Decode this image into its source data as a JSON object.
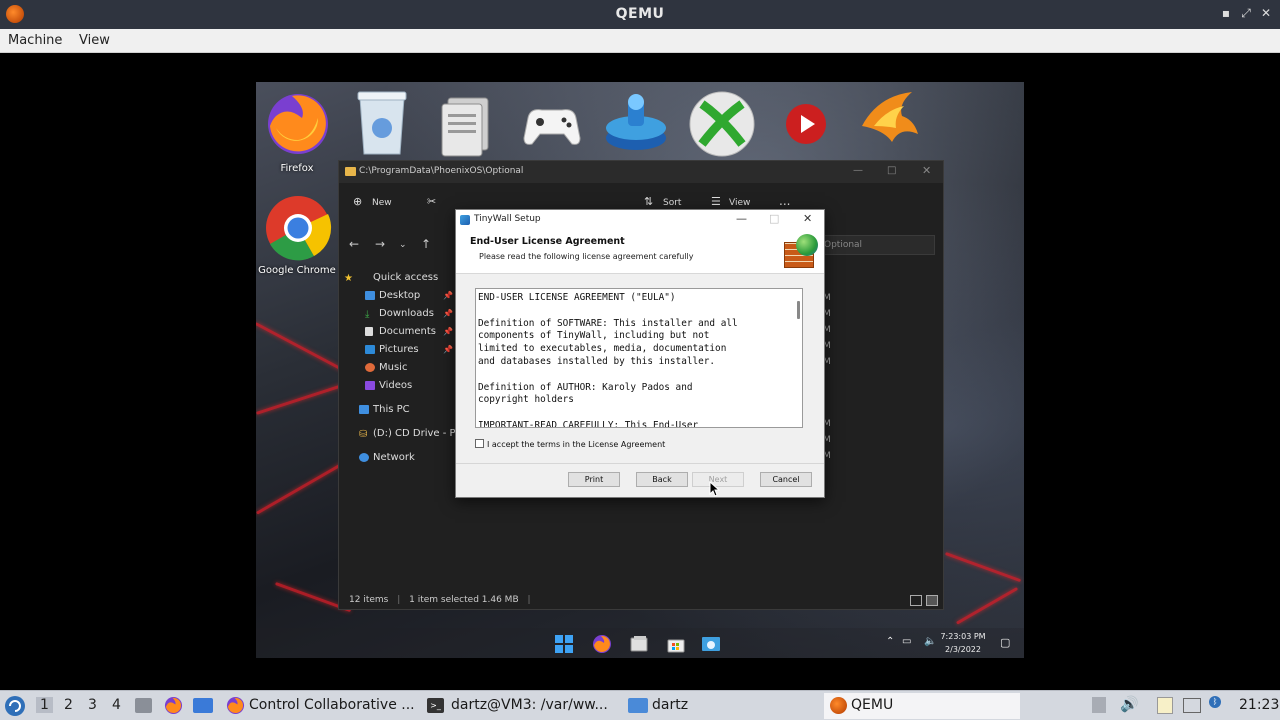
{
  "qemu": {
    "title": "QEMU",
    "menu": [
      "Machine",
      "View"
    ],
    "controls": {
      "minimize": "▪",
      "maximize": "⤢",
      "close": "✕"
    }
  },
  "desktop": {
    "icons": [
      {
        "name": "firefox",
        "label": "Firefox"
      },
      {
        "name": "recycle-bin",
        "label": ""
      },
      {
        "name": "files",
        "label": ""
      },
      {
        "name": "gamepad",
        "label": ""
      },
      {
        "name": "disk",
        "label": ""
      },
      {
        "name": "xbox",
        "label": ""
      },
      {
        "name": "youtube",
        "label": ""
      },
      {
        "name": "phoenix",
        "label": ""
      },
      {
        "name": "chrome",
        "label": "Google Chrome"
      }
    ]
  },
  "explorer": {
    "path": "C:\\ProgramData\\PhoenixOS\\Optional",
    "toolbar": {
      "new": "New",
      "sort": "Sort",
      "view": "View",
      "more": "..."
    },
    "search_placeholder": "Optional",
    "sidebar": {
      "quick_access": "Quick access",
      "items": [
        "Desktop",
        "Downloads",
        "Documents",
        "Pictures",
        "Music",
        "Videos"
      ],
      "this_pc": "This PC",
      "cd_drive": "(D:) CD Drive - Pho",
      "network": "Network"
    },
    "status": {
      "items": "12 items",
      "selected": "1 item selected  1.46 MB"
    },
    "fragments": [
      "M",
      "M",
      "M",
      "M",
      "M",
      "M",
      "M",
      "M"
    ]
  },
  "dialog": {
    "title": "TinyWall Setup",
    "header_title": "End-User License Agreement",
    "header_subtitle": "Please read the following license agreement carefully",
    "eula_text": "END-USER LICENSE AGREEMENT (\"EULA\")\n\nDefinition of SOFTWARE: This installer and all\ncomponents of TinyWall, including but not\nlimited to executables, media, documentation\nand databases installed by this installer.\n\nDefinition of AUTHOR: Karoly Pados and\ncopyright holders\n\nIMPORTANT-READ CAREFULLY: This End-User",
    "accept_label": "I accept the terms in the License Agreement",
    "buttons": {
      "print": "Print",
      "back": "Back",
      "next": "Next",
      "cancel": "Cancel"
    }
  },
  "guest_taskbar": {
    "time": "7:23:03 PM",
    "date": "2/3/2022"
  },
  "host_taskbar": {
    "workspaces": [
      "1",
      "2",
      "3",
      "4"
    ],
    "tasks": [
      {
        "label": "Control Collaborative ..."
      },
      {
        "label": "dartz@VM3: /var/ww..."
      },
      {
        "label": "dartz"
      },
      {
        "label": "QEMU"
      }
    ],
    "clock": "21:23"
  },
  "colors": {
    "host_titlebar": "#2f343f",
    "explorer_bg": "#202020",
    "dialog_bg": "#f0f0f0",
    "accent_red": "#dc1e28"
  }
}
